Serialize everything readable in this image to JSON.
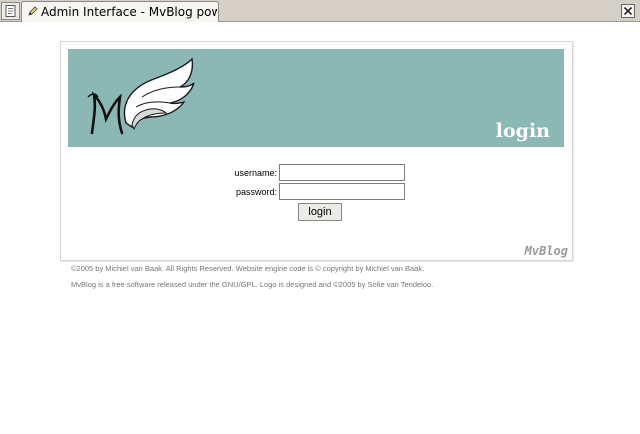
{
  "browser": {
    "tab_title": "Admin Interface - MvBlog pow...",
    "tab_menu_icon": "page-list-icon",
    "tab_icon": "pencil-icon",
    "close_icon": "close-x-icon"
  },
  "banner": {
    "title": "login",
    "logo_icon": "mvblog-wing-logo",
    "background_color": "#8bb8b5"
  },
  "form": {
    "username_label": "username:",
    "username_value": "",
    "password_label": "password:",
    "password_value": "",
    "submit_label": "login"
  },
  "brand": "MvBlog",
  "footer": {
    "line1": "©2005 by Michiel van Baak. All Rights Reserved. Website engine code is © copyright by Michiel van Baak.",
    "line2": "MvBlog is a free software released under the GNU/GPL. Logo is designed and ©2005 by Sofie van Tendeloo."
  }
}
